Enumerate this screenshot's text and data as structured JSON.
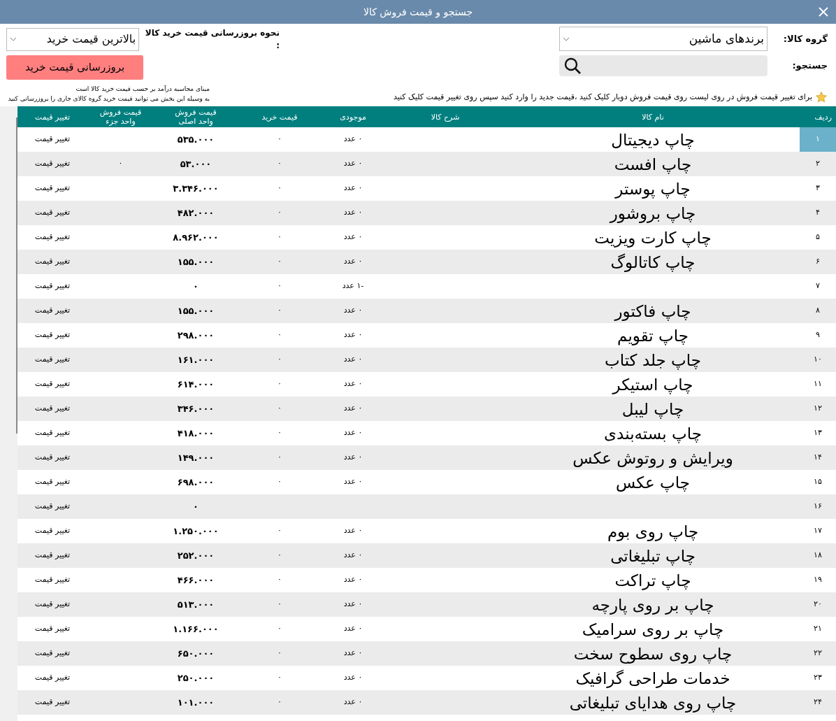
{
  "window": {
    "title": "جستجو و قیمت فروش کالا"
  },
  "filters": {
    "group_label": "گروه کالا:",
    "group_value": "برندهای ماشین",
    "search_label": "جستجو:",
    "hint": "برای تغییر قیمت فروش در روی لیست روی قیمت فروش دوبار کلیک کنید ،قیمت جدید را وارد کنید سپس روی تغییر قیمت کلیک کنید"
  },
  "update": {
    "label": "نحوه بروزرسانی قیمت خرید کالا :",
    "method_value": "بالاترین قیمت خرید",
    "button": "بروزرسانی قیمت خرید",
    "notes": [
      "مبنای محاسبه درآمد بر حسب قیمت خرید کالا است",
      "به وسیله این بخش می توانید قیمت خرید گروه کالای جاری را بروزرسانی کنید"
    ]
  },
  "table": {
    "columns": [
      "ردیف",
      "نام کالا",
      "شرح کالا",
      "موجودی",
      "قیمت خرید",
      "قیمت فروش\nواحد اصلی",
      "قیمت فروش\nواحد جزء",
      "تغییر قیمت"
    ],
    "rows": [
      {
        "index": "۱",
        "name": "چاپ دیجیتال",
        "stock": "۰ عدد",
        "buy": "۰",
        "sale": "۵۳۵.۰۰۰",
        "part": "",
        "action": "تغییر قیمت",
        "selected": true
      },
      {
        "index": "۲",
        "name": "چاپ افست",
        "stock": "۰ عدد",
        "buy": "۰",
        "sale": "۵۳.۰۰۰",
        "part": "۰",
        "action": "تغییر قیمت",
        "selected": false
      },
      {
        "index": "۳",
        "name": "چاپ پوستر",
        "stock": "۰ عدد",
        "buy": "۰",
        "sale": "۳.۳۴۶.۰۰۰",
        "part": "",
        "action": "تغییر قیمت",
        "selected": false
      },
      {
        "index": "۴",
        "name": "چاپ بروشور",
        "stock": "۰ عدد",
        "buy": "۰",
        "sale": "۴۸۲.۰۰۰",
        "part": "",
        "action": "تغییر قیمت",
        "selected": false
      },
      {
        "index": "۵",
        "name": "چاپ کارت ویزیت",
        "stock": "۰ عدد",
        "buy": "۰",
        "sale": "۸.۹۶۲.۰۰۰",
        "part": "",
        "action": "تغییر قیمت",
        "selected": false
      },
      {
        "index": "۶",
        "name": "چاپ کاتالوگ",
        "stock": "۰ عدد",
        "buy": "۰",
        "sale": "۱۵۵.۰۰۰",
        "part": "",
        "action": "تغییر قیمت",
        "selected": false
      },
      {
        "index": "۷",
        "name": "",
        "stock": "-۱ عدد",
        "buy": "۰",
        "sale": "۰",
        "part": "",
        "action": "تغییر قیمت",
        "selected": false
      },
      {
        "index": "۸",
        "name": "چاپ فاکتور",
        "stock": "۰ عدد",
        "buy": "۰",
        "sale": "۱۵۵.۰۰۰",
        "part": "",
        "action": "تغییر قیمت",
        "selected": false
      },
      {
        "index": "۹",
        "name": "چاپ تقویم",
        "stock": "۰ عدد",
        "buy": "۰",
        "sale": "۲۹۸.۰۰۰",
        "part": "",
        "action": "تغییر قیمت",
        "selected": false
      },
      {
        "index": "۱۰",
        "name": "چاپ جلد کتاب",
        "stock": "۰ عدد",
        "buy": "۰",
        "sale": "۱۶۱.۰۰۰",
        "part": "",
        "action": "تغییر قیمت",
        "selected": false
      },
      {
        "index": "۱۱",
        "name": "چاپ استیکر",
        "stock": "۰ عدد",
        "buy": "۰",
        "sale": "۶۱۴.۰۰۰",
        "part": "",
        "action": "تغییر قیمت",
        "selected": false
      },
      {
        "index": "۱۲",
        "name": "چاپ لیبل",
        "stock": "۰ عدد",
        "buy": "۰",
        "sale": "۳۴۶.۰۰۰",
        "part": "",
        "action": "تغییر قیمت",
        "selected": false
      },
      {
        "index": "۱۳",
        "name": "چاپ بسته‌بندی",
        "stock": "۰ عدد",
        "buy": "۰",
        "sale": "۴۱۸.۰۰۰",
        "part": "",
        "action": "تغییر قیمت",
        "selected": false
      },
      {
        "index": "۱۴",
        "name": "ویرایش و روتوش عکس",
        "stock": "۰ عدد",
        "buy": "۰",
        "sale": "۱۴۹.۰۰۰",
        "part": "",
        "action": "تغییر قیمت",
        "selected": false
      },
      {
        "index": "۱۵",
        "name": "چاپ عکس",
        "stock": "۰ عدد",
        "buy": "۰",
        "sale": "۶۹۸.۰۰۰",
        "part": "",
        "action": "تغییر قیمت",
        "selected": false
      },
      {
        "index": "۱۶",
        "name": "",
        "stock": "",
        "buy": "",
        "sale": "۰",
        "part": "",
        "action": "تغییر قیمت",
        "selected": false
      },
      {
        "index": "۱۷",
        "name": "چاپ روی بوم",
        "stock": "۰ عدد",
        "buy": "۰",
        "sale": "۱.۲۵۰.۰۰۰",
        "part": "",
        "action": "تغییر قیمت",
        "selected": false
      },
      {
        "index": "۱۸",
        "name": "چاپ تبلیغاتی",
        "stock": "۰ عدد",
        "buy": "۰",
        "sale": "۲۵۲.۰۰۰",
        "part": "",
        "action": "تغییر قیمت",
        "selected": false
      },
      {
        "index": "۱۹",
        "name": "چاپ تراکت",
        "stock": "۰ عدد",
        "buy": "۰",
        "sale": "۴۶۶.۰۰۰",
        "part": "",
        "action": "تغییر قیمت",
        "selected": false
      },
      {
        "index": "۲۰",
        "name": "چاپ بر روی پارچه",
        "stock": "۰ عدد",
        "buy": "۰",
        "sale": "۵۱۳.۰۰۰",
        "part": "",
        "action": "تغییر قیمت",
        "selected": false
      },
      {
        "index": "۲۱",
        "name": "چاپ بر روی سرامیک",
        "stock": "۰ عدد",
        "buy": "۰",
        "sale": "۱.۱۶۶.۰۰۰",
        "part": "",
        "action": "تغییر قیمت",
        "selected": false
      },
      {
        "index": "۲۲",
        "name": "چاپ روی سطوح سخت",
        "stock": "۰ عدد",
        "buy": "۰",
        "sale": "۶۵۰.۰۰۰",
        "part": "",
        "action": "تغییر قیمت",
        "selected": false
      },
      {
        "index": "۲۳",
        "name": "خدمات طراحی گرافیک",
        "stock": "۰ عدد",
        "buy": "۰",
        "sale": "۲۵۰.۰۰۰",
        "part": "",
        "action": "تغییر قیمت",
        "selected": false
      },
      {
        "index": "۲۴",
        "name": "چاپ روی هدایای تبلیغاتی",
        "stock": "۰ عدد",
        "buy": "۰",
        "sale": "۱۰۱.۰۰۰",
        "part": "",
        "action": "تغییر قیمت",
        "selected": false
      }
    ]
  }
}
